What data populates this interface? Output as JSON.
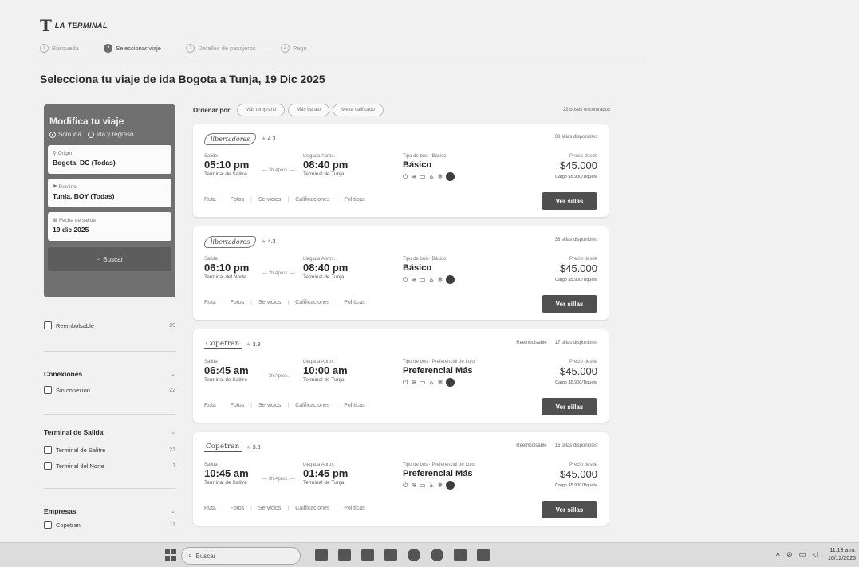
{
  "header": {
    "logo_mark": "T",
    "logo_text": "LA TERMINAL",
    "steps": [
      {
        "num": "1",
        "label": "Búsqueda"
      },
      {
        "num": "2",
        "label": "Seleccionar viaje"
      },
      {
        "num": "3",
        "label": "Detalles de pasajeros"
      },
      {
        "num": "4",
        "label": "Pago"
      }
    ]
  },
  "page_title": "Selecciona tu viaje de ida Bogota a Tunja, 19 Dic 2025",
  "search": {
    "title": "Modifica tu viaje",
    "radio_one_way": "Solo ida",
    "radio_round": "Ida y regreso",
    "origin_label": "Origen",
    "origin_value": "Bogota, DC (Todas)",
    "dest_label": "Destino",
    "dest_value": "Tunja, BOY (Todas)",
    "date_label": "Fecha de salida",
    "date_value": "19 dic 2025",
    "button": "Buscar"
  },
  "filters": {
    "refundable": {
      "label": "Reembolsable",
      "count": "20"
    },
    "connections": {
      "title": "Conexiones",
      "option": "Sin conexión",
      "count": "22"
    },
    "terminal": {
      "title": "Terminal de Salida",
      "options": [
        {
          "label": "Terminal de Salitre",
          "count": "21"
        },
        {
          "label": "Terminal del Norte",
          "count": "1"
        }
      ]
    },
    "companies": {
      "title": "Empresas",
      "option": "Copetran",
      "count": "11"
    }
  },
  "sort": {
    "label": "Ordenar por:",
    "chips": [
      "Más temprano",
      "Más barato",
      "Mejor calificado"
    ],
    "found": "22 buses encontrados"
  },
  "labels": {
    "departure": "Salida",
    "arrival": "Llegada Aprox.",
    "price_from": "Precio desde",
    "fee": "Cargo $5.900/Tiquete",
    "cta": "Ver sillas",
    "links": [
      "Ruta",
      "Fotos",
      "Servicios",
      "Calificaciones",
      "Políticas"
    ]
  },
  "trips": [
    {
      "brand": "libertadores",
      "rating": "4.3",
      "badges": [
        "38 sillas disponibles"
      ],
      "dep_time": "05:10 pm",
      "dep_terminal": "Terminal de Salitre",
      "duration": "3h Aprox.",
      "arr_time": "08:40 pm",
      "arr_terminal": "Terminal de Tunja",
      "bus_label": "Tipo de bus · Básico",
      "bus_type": "Básico",
      "price": "$45.000"
    },
    {
      "brand": "libertadores",
      "rating": "4.3",
      "badges": [
        "36 sillas disponibles"
      ],
      "dep_time": "06:10 pm",
      "dep_terminal": "Terminal del Norte",
      "duration": "2h Aprox.",
      "arr_time": "08:40 pm",
      "arr_terminal": "Terminal de Tunja",
      "bus_label": "Tipo de bus · Básico",
      "bus_type": "Básico",
      "price": "$45.000"
    },
    {
      "brand": "Copetran",
      "rating": "3.8",
      "badges": [
        "Reembolsable",
        "17 sillas disponibles"
      ],
      "dep_time": "06:45 am",
      "dep_terminal": "Terminal de Salitre",
      "duration": "3h Aprox.",
      "arr_time": "10:00 am",
      "arr_terminal": "Terminal de Tunja",
      "bus_label": "Tipo de bus · Preferencial de Lujo",
      "bus_type": "Preferencial Más",
      "price": "$45.000"
    },
    {
      "brand": "Copetran",
      "rating": "3.8",
      "badges": [
        "Reembolsable",
        "16 sillas disponibles"
      ],
      "dep_time": "10:45 am",
      "dep_terminal": "Terminal de Salitre",
      "duration": "3h Aprox.",
      "arr_time": "01:45 pm",
      "arr_terminal": "Terminal de Tunja",
      "bus_label": "Tipo de bus · Preferencial de Lujo",
      "bus_type": "Preferencial Más",
      "price": "$45.000"
    }
  ],
  "taskbar": {
    "search_placeholder": "Buscar",
    "time": "11:13 a.m.",
    "date": "10/12/2025"
  },
  "icons": {
    "origin": "pin-icon",
    "destination": "flag-icon",
    "date": "calendar-icon",
    "search": "magnifier-icon",
    "star": "star-icon"
  }
}
